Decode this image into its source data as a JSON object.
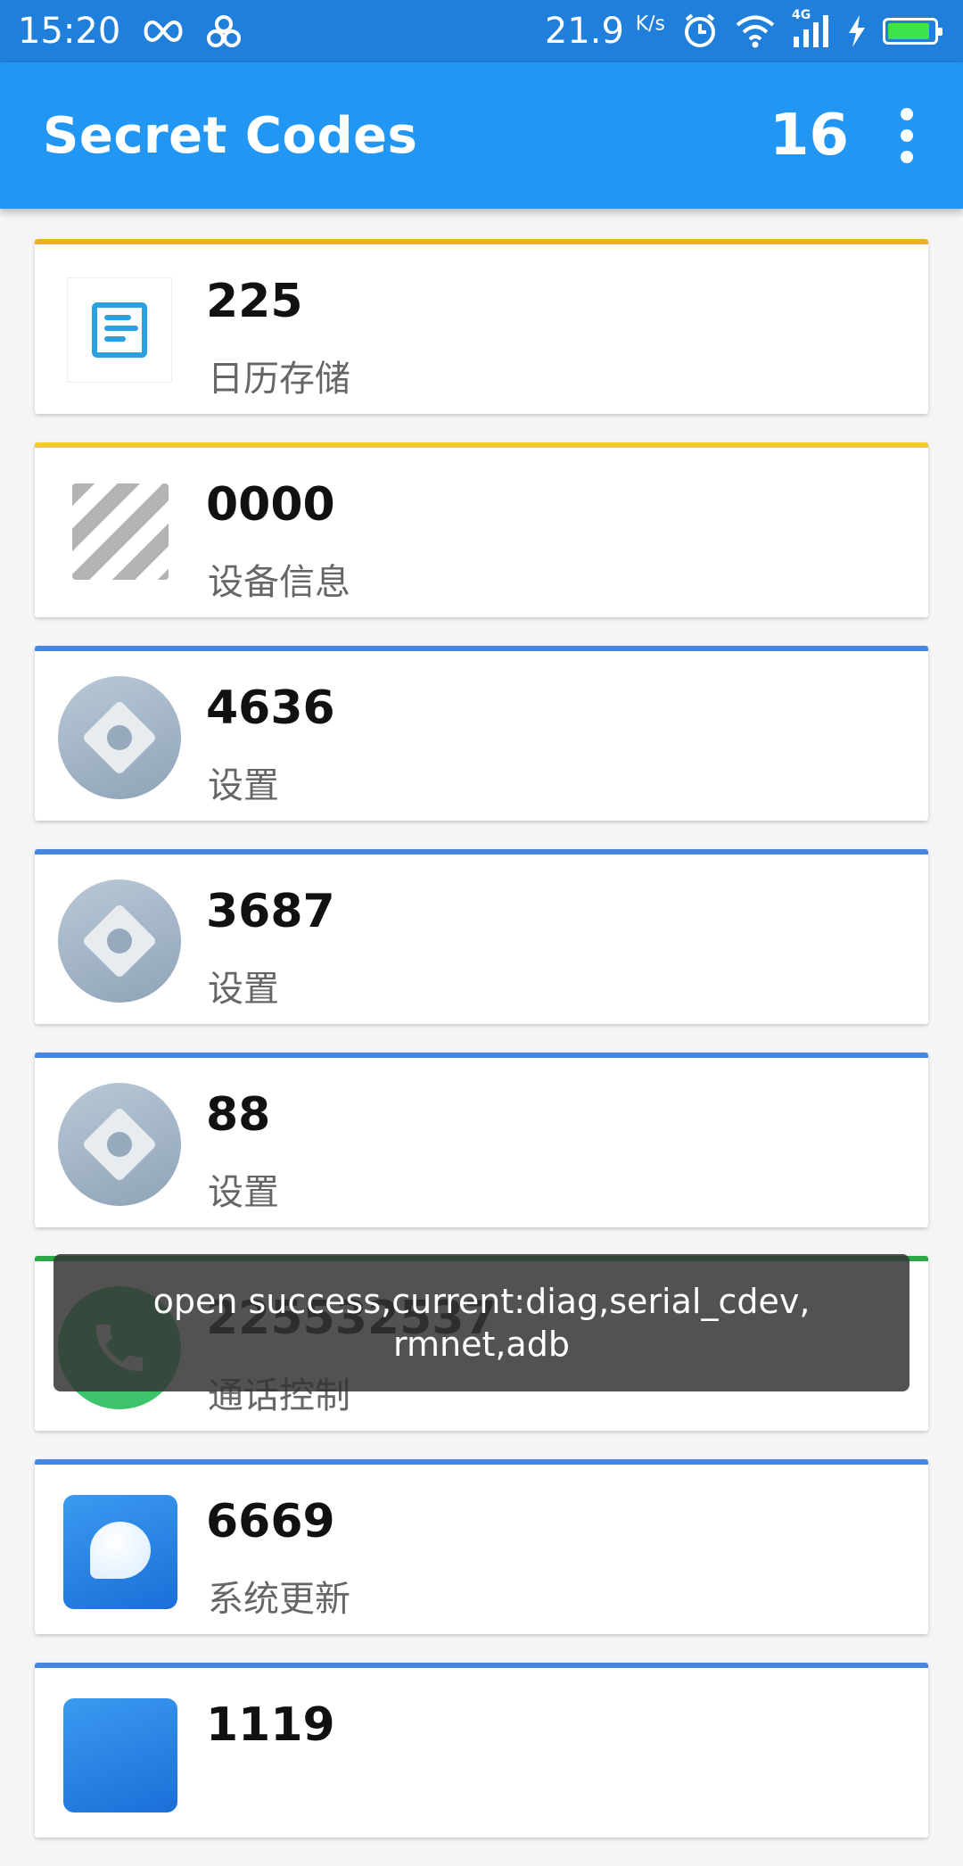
{
  "status_bar": {
    "time": "15:20",
    "speed": "21.9",
    "speed_unit": "K/s",
    "network": "4G",
    "icons": [
      "infinity-icon",
      "pinwheel-icon",
      "alarm-icon",
      "wifi-icon",
      "signal-icon",
      "charging-icon",
      "battery-icon"
    ]
  },
  "appbar": {
    "title": "Secret Codes",
    "count": "16"
  },
  "cards": [
    {
      "code": "225",
      "desc": "日历存储",
      "accent": "#e8b21b",
      "icon": "calendar-storage-icon"
    },
    {
      "code": "0000",
      "desc": "设备信息",
      "accent": "#efc93a",
      "icon": "device-info-icon"
    },
    {
      "code": "4636",
      "desc": "设置",
      "accent": "#4a86e0",
      "icon": "settings-icon"
    },
    {
      "code": "3687",
      "desc": "设置",
      "accent": "#4a86e0",
      "icon": "settings-icon"
    },
    {
      "code": "88",
      "desc": "设置",
      "accent": "#4a86e0",
      "icon": "settings-icon"
    },
    {
      "code": "225532537",
      "desc": "通话控制",
      "accent": "#2aa845",
      "icon": "phone-icon"
    },
    {
      "code": "6669",
      "desc": "系统更新",
      "accent": "#4a86e0",
      "icon": "system-update-icon"
    },
    {
      "code": "1119",
      "desc": "",
      "accent": "#4a86e0",
      "icon": "app-icon"
    }
  ],
  "toast": {
    "message": "open success,current:diag,serial_cdev,\nrmnet,adb"
  },
  "colors": {
    "status_bar": "#1f7fdb",
    "app_bar": "#2196f3",
    "background": "#f5f5f5"
  }
}
